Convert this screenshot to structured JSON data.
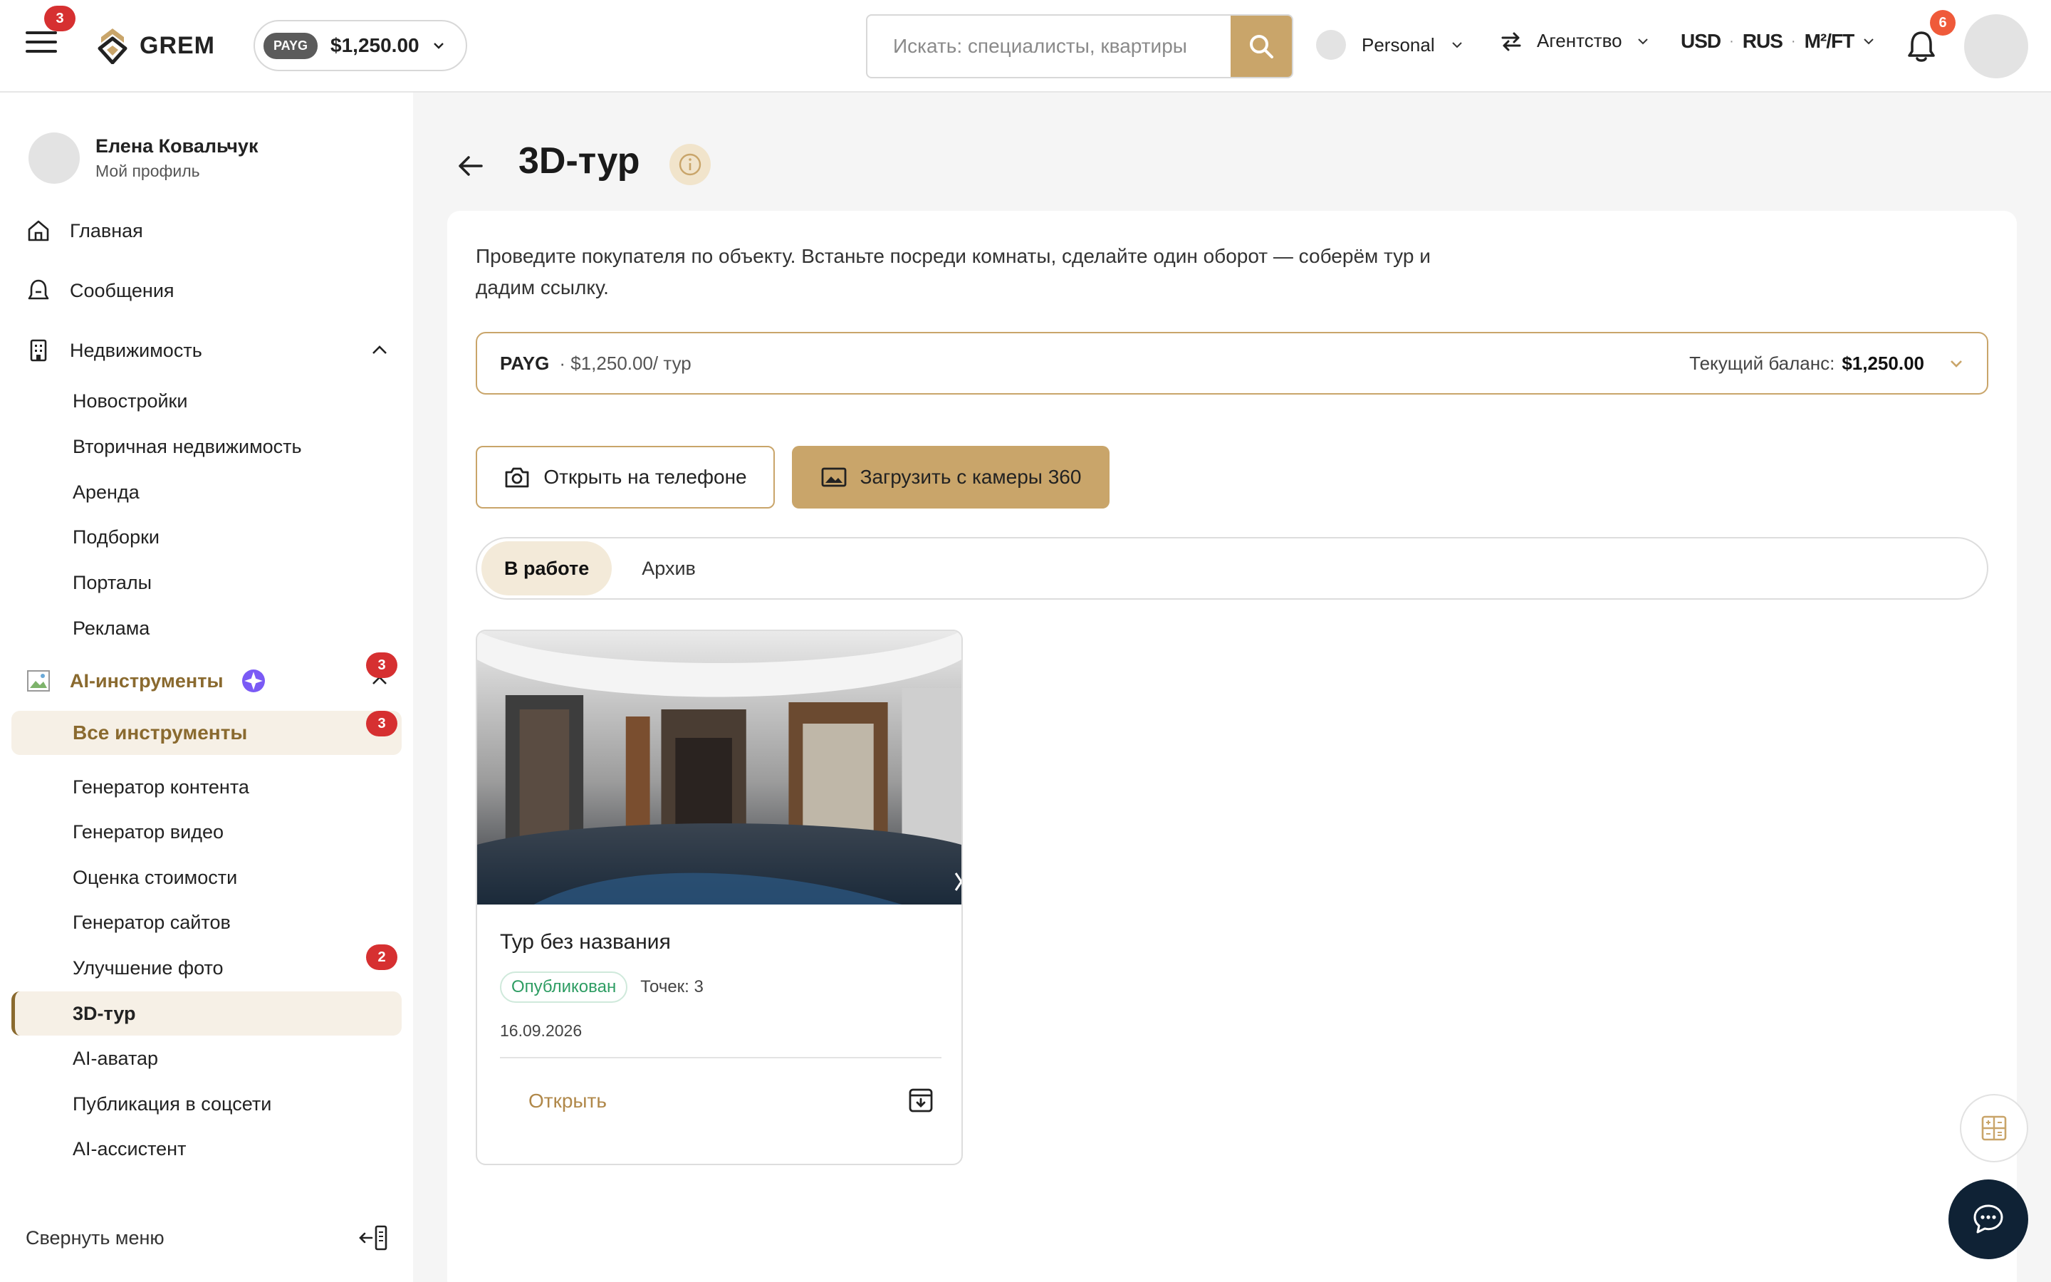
{
  "header": {
    "menu_badge": "3",
    "logo_text": "GREM",
    "payg_chip": "PAYG",
    "balance": "$1,250.00",
    "search_placeholder": "Искать: специалисты, квартиры",
    "profile_label": "Personal",
    "agency_label": "Агентство",
    "currency": "USD",
    "language": "RUS",
    "unit": "M²/FT",
    "notif_badge": "6"
  },
  "sidebar": {
    "user_name": "Елена Ковальчук",
    "user_sub": "Мой профиль",
    "home": "Главная",
    "messages": "Сообщения",
    "realty": "Недвижимость",
    "realty_items": [
      "Новостройки",
      "Вторичная недвижимость",
      "Аренда",
      "Подборки",
      "Порталы",
      "Реклама"
    ],
    "ai_tools": "AI-инструменты",
    "ai_badge": "3",
    "all_tools": "Все инструменты",
    "all_tools_badge": "3",
    "ai_items": [
      "Генератор контента",
      "Генератор видео",
      "Оценка стоимости",
      "Генератор сайтов",
      "Улучшение фото",
      "3D-тур",
      "AI-аватар",
      "Публикация в соцсети",
      "AI-ассистент"
    ],
    "photo_badge": "2",
    "collapse": "Свернуть меню"
  },
  "main": {
    "title": "3D-тур",
    "intro": "Проведите покупателя по объекту. Встаньте посреди комнаты, сделайте один оборот — соберём тур и дадим ссылку.",
    "plan_name": "PAYG",
    "plan_price": "· $1,250.00/ тур",
    "balance_label": "Текущий баланс:",
    "balance_value": "$1,250.00",
    "btn_phone": "Открыть на телефоне",
    "btn_camera": "Загрузить с камеры 360",
    "tab_active": "В работе",
    "tab_archive": "Архив",
    "tour": {
      "title": "Тур без названия",
      "status": "Опубликован",
      "points": "Точек: 3",
      "date": "16.09.2026",
      "open": "Открыть"
    }
  },
  "colors": {
    "accent": "#c9a56a",
    "accent_dark": "#8a6a2f",
    "badge_red": "#d63031",
    "success": "#2e9d63",
    "chat_bg": "#0f2235"
  }
}
